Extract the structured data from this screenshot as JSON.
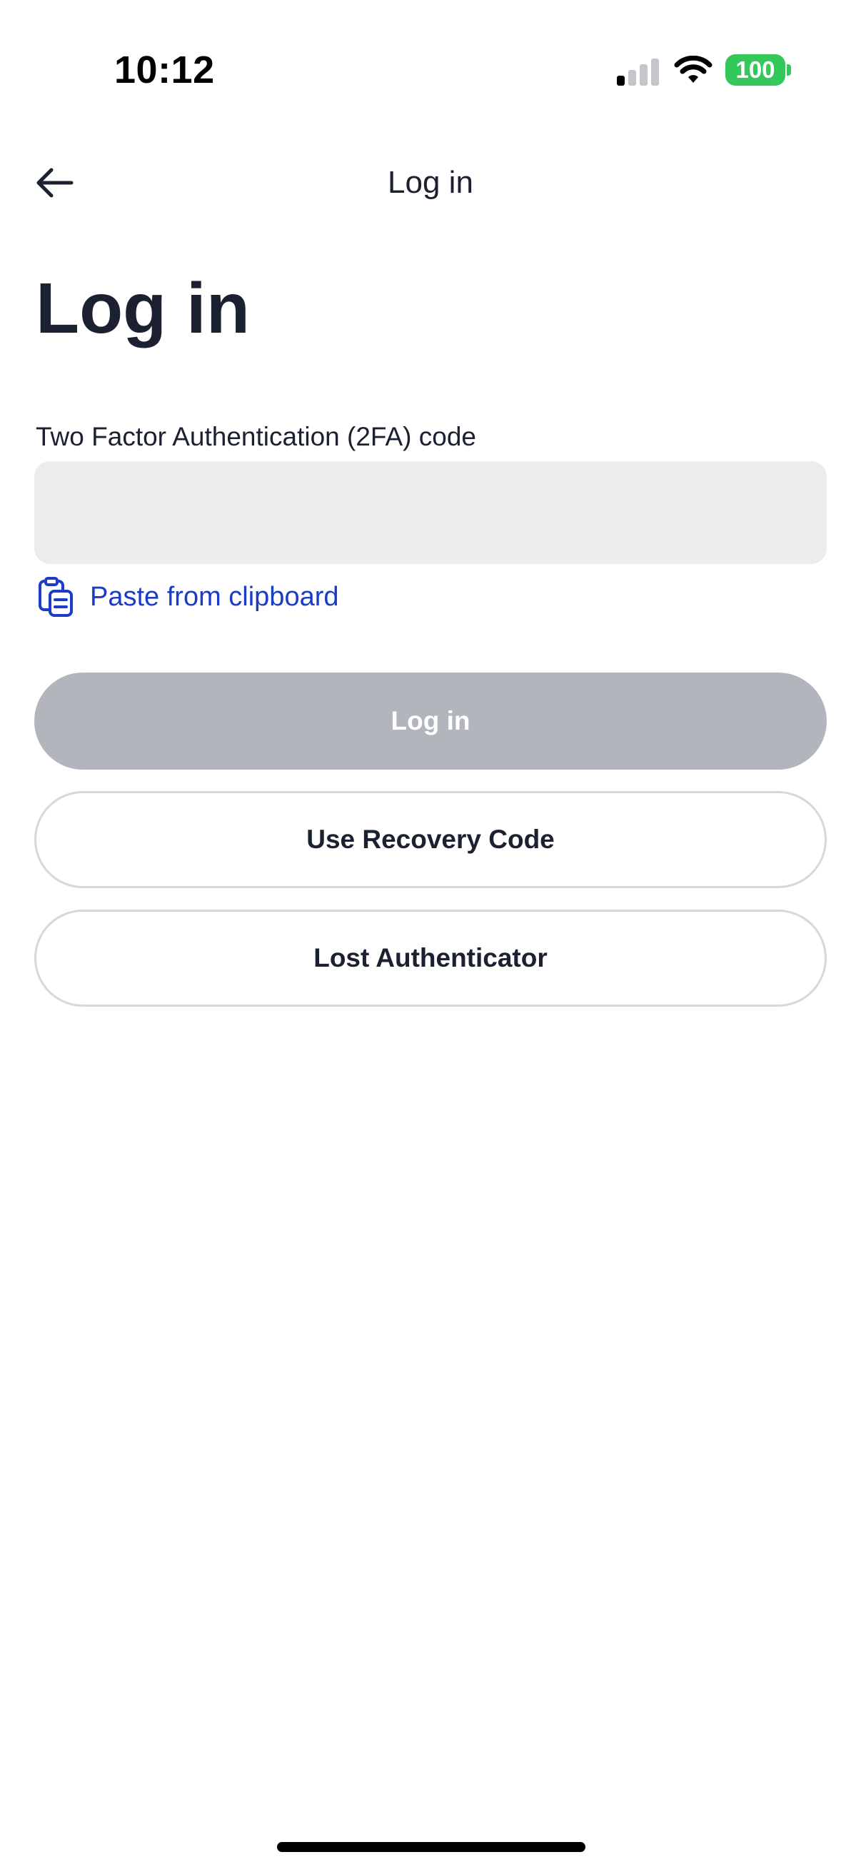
{
  "status_bar": {
    "time": "10:12",
    "battery": "100",
    "signal_bars_active": 1,
    "signal_bars_total": 4
  },
  "nav": {
    "title": "Log in",
    "back_icon": "arrow-left-icon"
  },
  "heading": "Log in",
  "form": {
    "code_label": "Two Factor Authentication (2FA) code",
    "code_value": "",
    "paste_label": "Paste from clipboard",
    "paste_icon": "clipboard-icon"
  },
  "buttons": {
    "login": "Log in",
    "recovery": "Use Recovery Code",
    "lost": "Lost Authenticator"
  },
  "colors": {
    "accent": "#1a3cc6",
    "text": "#1b2130",
    "disabled_button": "#b2b5bb",
    "input_bg": "#ebecee",
    "battery": "#34c759"
  }
}
